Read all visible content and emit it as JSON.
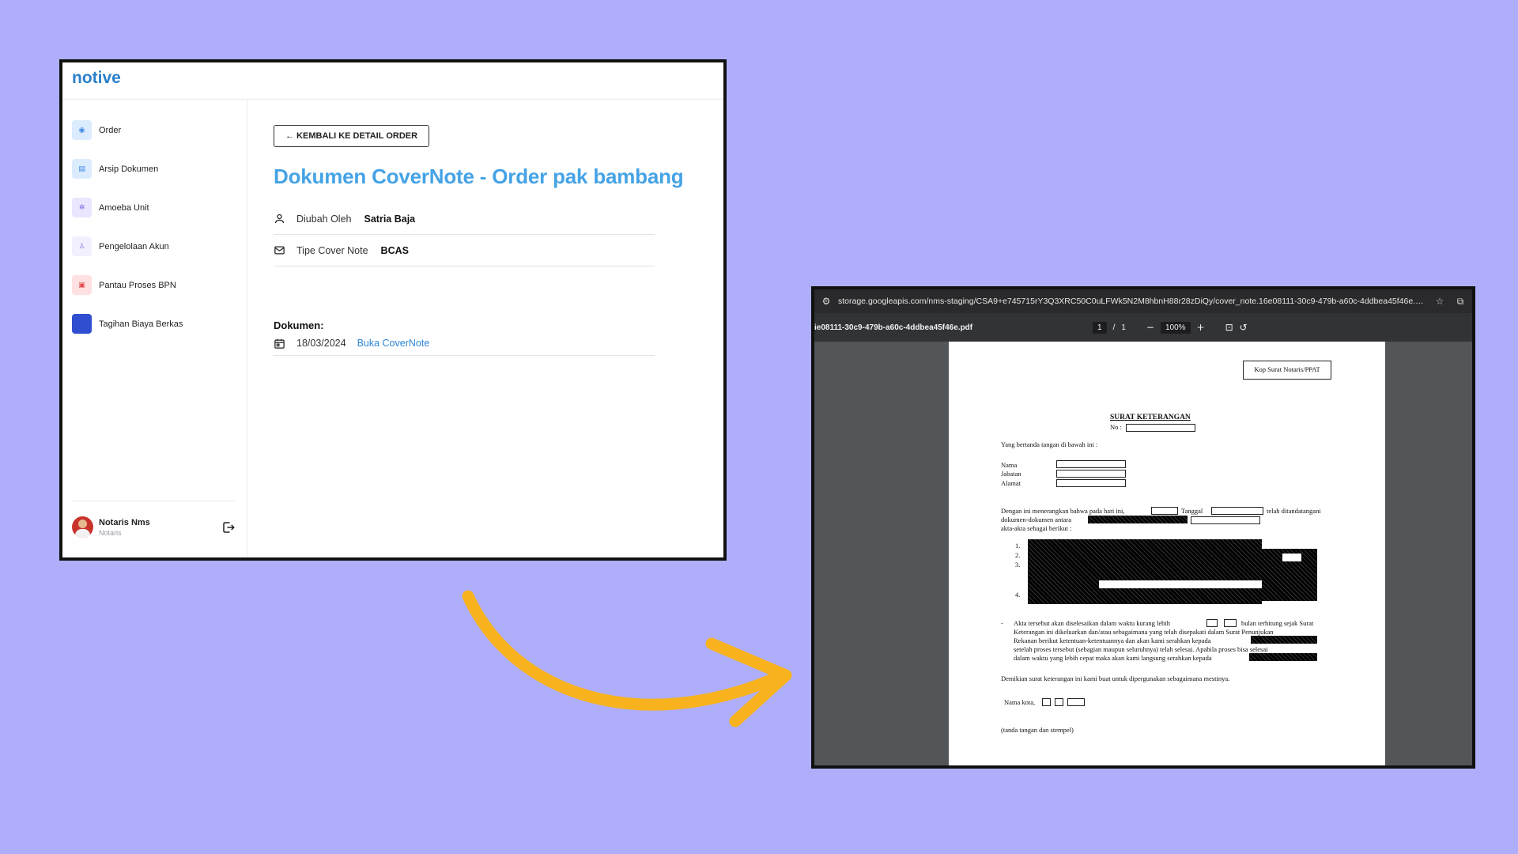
{
  "app": {
    "logo": "notive",
    "sidebar": {
      "items": [
        {
          "label": "Order",
          "icon": "eye-icon",
          "bg": "#dcecff",
          "fg": "#3b86e0"
        },
        {
          "label": "Arsip Dokumen",
          "icon": "archive-icon",
          "bg": "#dcecff",
          "fg": "#3b86e0"
        },
        {
          "label": "Amoeba Unit",
          "icon": "users-icon",
          "bg": "#ebe6ff",
          "fg": "#7a5fe0"
        },
        {
          "label": "Pengelolaan Akun",
          "icon": "user-icon",
          "bg": "#f2f0ff",
          "fg": "#8a7de0"
        },
        {
          "label": "Pantau Proses BPN",
          "icon": "clipboard-icon",
          "bg": "#ffe1e1",
          "fg": "#e04848"
        },
        {
          "label": "Tagihan Biaya Berkas",
          "icon": "bill-icon",
          "bg": "#2f4fd0",
          "fg": "#ffffff"
        }
      ]
    },
    "user": {
      "name": "Notaris Nms",
      "role": "Notaris"
    },
    "main": {
      "back_button": "← KEMBALI KE DETAIL ORDER",
      "title": "Dokumen CoverNote - Order pak bambang",
      "changed_by_label": "Diubah Oleh",
      "changed_by_value": "Satria Baja",
      "cover_type_label": "Tipe Cover Note",
      "cover_type_value": "BCAS",
      "documents_label": "Dokumen:",
      "document_date": "18/03/2024",
      "document_link": "Buka CoverNote"
    }
  },
  "viewer": {
    "url": "storage.googleapis.com/nms-staging/CSA9+e745715rY3Q3XRC50C0uLFWk5N2M8hbnH88r28zDiQy/cover_note.16e08111-30c9-479b-a60c-4ddbea45f46e.p...",
    "file_name": "ie08111-30c9-479b-a60c-4ddbea45f46e.pdf",
    "page_current": "1",
    "page_separator": "/",
    "page_total": "1",
    "zoom": "100%",
    "doc": {
      "kop": "Kop Surat Notaris/PPAT",
      "heading": "SURAT KETERANGAN",
      "no_label": "No :",
      "intro": "Yang bertanda tangan di bawah ini :",
      "nama": "Nama",
      "jabatan": "Jabatan",
      "alamat": "Alamat",
      "p1_a": "Dengan ini menerangkan bahwa pada hari ini,",
      "p1_b": "Tanggal",
      "p1_c": "telah ditandatangani",
      "p1_d": "dokumen-dokumen antara",
      "p1_e": "akta-akta sebagai berikut :",
      "n1": "1.",
      "n2": "2.",
      "n3": "3.",
      "n4": "4.",
      "dash": "-",
      "p2_l1": "Akta tersebut akan diselesaikan dalam waktu kurang lebih",
      "p2_l1b": "bulan terhitung sejak Surat",
      "p2_l2": "Keterangan ini dikeluarkan dan/atau sebagaimana yang telah disepakati dalam Surat Penunjukan",
      "p2_l3": "Rekanan berikut ketentuan-ketentuannya dan akan kami serahkan kepada",
      "p2_l4": "setelah proses tersebut (sebagian maupun seluruhnya) telah selesai. Apabila proses bisa selesai",
      "p2_l5": "dalam waktu yang lebih cepat maka akan kami langsung serahkan kepada",
      "closing": "Demikian surat keterangan ini kami buat untuk dipergunakan sebagaimana mestinya.",
      "city": "Nama kota,",
      "signature": "(tanda tangan dan stempel)"
    }
  },
  "colors": {
    "background": "#aeaefb",
    "accent": "#45a3e6",
    "arrow": "#f7b21e"
  }
}
